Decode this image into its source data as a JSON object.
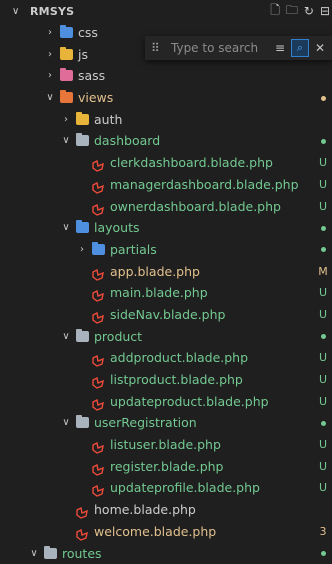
{
  "header": {
    "title": "RMSYS",
    "chevron": "∨",
    "actions": [
      "new-file-icon",
      "new-folder-icon",
      "refresh-icon",
      "collapse-icon"
    ]
  },
  "search": {
    "placeholder": "Type to search",
    "filter_icon": "filter-icon",
    "fuzzy_icon": "fuzzy-match-icon",
    "close_icon": "close-icon"
  },
  "colors": {
    "untracked": "#73c991",
    "modified": "#e2c08d",
    "folder_blue": "#4e8fe0",
    "folder_yellow": "#e8b43a",
    "folder_pink": "#e06c9a",
    "folder_views": "#e8753a",
    "folder_plain": "#a9b3bd",
    "laravel": "#ef4b3b"
  },
  "tree": [
    {
      "name": "css",
      "depth": 1,
      "type": "folder",
      "open": false,
      "icon": "css-folder-icon",
      "status": "",
      "color": ""
    },
    {
      "name": "js",
      "depth": 1,
      "type": "folder",
      "open": false,
      "icon": "js-folder-icon",
      "status": "",
      "color": ""
    },
    {
      "name": "sass",
      "depth": 1,
      "type": "folder",
      "open": false,
      "icon": "sass-folder-icon",
      "status": "",
      "color": ""
    },
    {
      "name": "views",
      "depth": 1,
      "type": "folder",
      "open": true,
      "icon": "views-folder-icon",
      "status": "dot",
      "color": "modified"
    },
    {
      "name": "auth",
      "depth": 2,
      "type": "folder",
      "open": false,
      "icon": "auth-folder-icon",
      "status": "",
      "color": ""
    },
    {
      "name": "dashboard",
      "depth": 2,
      "type": "folder",
      "open": true,
      "icon": "folder-icon",
      "status": "dot",
      "color": "untracked"
    },
    {
      "name": "clerkdashboard.blade.php",
      "depth": 3,
      "type": "file",
      "status": "U",
      "color": "untracked"
    },
    {
      "name": "managerdashboard.blade.php",
      "depth": 3,
      "type": "file",
      "status": "U",
      "color": "untracked"
    },
    {
      "name": "ownerdashboard.blade.php",
      "depth": 3,
      "type": "file",
      "status": "U",
      "color": "untracked"
    },
    {
      "name": "layouts",
      "depth": 2,
      "type": "folder",
      "open": true,
      "icon": "layouts-folder-icon",
      "status": "dot",
      "color": "untracked"
    },
    {
      "name": "partials",
      "depth": 3,
      "type": "folder",
      "open": false,
      "icon": "partials-folder-icon",
      "status": "dot",
      "color": "untracked"
    },
    {
      "name": "app.blade.php",
      "depth": 3,
      "type": "file",
      "status": "M",
      "color": "modified"
    },
    {
      "name": "main.blade.php",
      "depth": 3,
      "type": "file",
      "status": "U",
      "color": "untracked"
    },
    {
      "name": "sideNav.blade.php",
      "depth": 3,
      "type": "file",
      "status": "U",
      "color": "untracked"
    },
    {
      "name": "product",
      "depth": 2,
      "type": "folder",
      "open": true,
      "icon": "folder-icon",
      "status": "dot",
      "color": "untracked"
    },
    {
      "name": "addproduct.blade.php",
      "depth": 3,
      "type": "file",
      "status": "U",
      "color": "untracked"
    },
    {
      "name": "listproduct.blade.php",
      "depth": 3,
      "type": "file",
      "status": "U",
      "color": "untracked"
    },
    {
      "name": "updateproduct.blade.php",
      "depth": 3,
      "type": "file",
      "status": "U",
      "color": "untracked"
    },
    {
      "name": "userRegistration",
      "depth": 2,
      "type": "folder",
      "open": true,
      "icon": "folder-icon",
      "status": "dot",
      "color": "untracked"
    },
    {
      "name": "listuser.blade.php",
      "depth": 3,
      "type": "file",
      "status": "U",
      "color": "untracked"
    },
    {
      "name": "register.blade.php",
      "depth": 3,
      "type": "file",
      "status": "U",
      "color": "untracked"
    },
    {
      "name": "updateprofile.blade.php",
      "depth": 3,
      "type": "file",
      "status": "U",
      "color": "untracked"
    },
    {
      "name": "home.blade.php",
      "depth": 2,
      "type": "file",
      "status": "",
      "color": ""
    },
    {
      "name": "welcome.blade.php",
      "depth": 2,
      "type": "file",
      "status": "3",
      "color": "modified"
    },
    {
      "name": "routes",
      "depth": 0,
      "type": "folder",
      "open": true,
      "icon": "routes-folder-icon",
      "status": "dot",
      "color": "untracked"
    }
  ]
}
